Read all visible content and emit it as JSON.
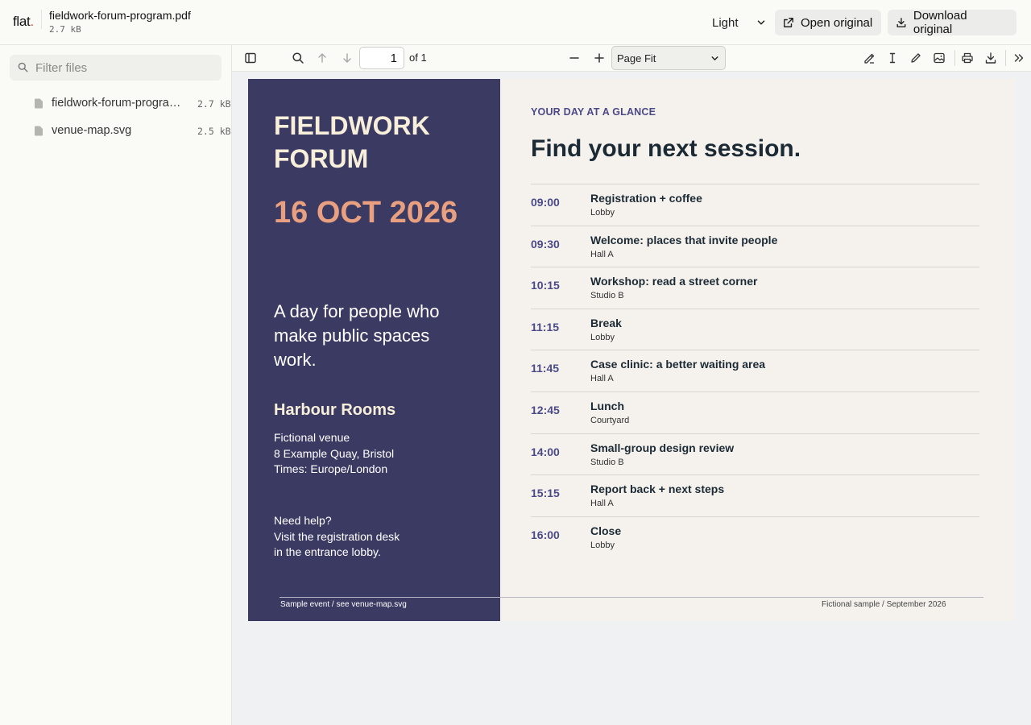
{
  "header": {
    "logo_text": "flat",
    "logo_dot": ".",
    "file_title": "fieldwork-forum-program.pdf",
    "file_size": "2.7 kB",
    "theme_value": "Light",
    "open_label": "Open original",
    "download_label": "Download original"
  },
  "sidebar": {
    "filter_placeholder": "Filter files",
    "files": [
      {
        "name": "fieldwork-forum-program.pdf",
        "size": "2.7 kB",
        "icon": "file-icon"
      },
      {
        "name": "venue-map.svg",
        "size": "2.5 kB",
        "icon": "file-icon"
      }
    ]
  },
  "viewer": {
    "page_number": "1",
    "page_count": "of 1",
    "zoom_value": "Page Fit"
  },
  "document": {
    "title": "FIELDWORK FORUM",
    "date": "16 OCT 2026",
    "tagline": "A day for people who make public spaces work.",
    "venue": "Harbour Rooms",
    "address_lines": [
      "Fictional venue",
      "8 Example Quay, Bristol",
      "Times: Europe/London"
    ],
    "help_lines": [
      "Need help?",
      "Visit the registration desk",
      "in the entrance lobby."
    ],
    "kicker": "YOUR DAY AT A GLANCE",
    "heading": "Find your next session.",
    "schedule": [
      {
        "time": "09:00",
        "title": "Registration + coffee",
        "room": "Lobby"
      },
      {
        "time": "09:30",
        "title": "Welcome: places that invite people",
        "room": "Hall A"
      },
      {
        "time": "10:15",
        "title": "Workshop: read a street corner",
        "room": "Studio B"
      },
      {
        "time": "11:15",
        "title": "Break",
        "room": "Lobby"
      },
      {
        "time": "11:45",
        "title": "Case clinic: a better waiting area",
        "room": "Hall A"
      },
      {
        "time": "12:45",
        "title": "Lunch",
        "room": "Courtyard"
      },
      {
        "time": "14:00",
        "title": "Small-group design review",
        "room": "Studio B"
      },
      {
        "time": "15:15",
        "title": "Report back + next steps",
        "room": "Hall A"
      },
      {
        "time": "16:00",
        "title": "Close",
        "room": "Lobby"
      }
    ],
    "footer_left": "Sample event / see venue-map.svg",
    "footer_right": "Fictional sample / September 2026"
  },
  "colors": {
    "panel": "#3b3a63",
    "accent_time": "#4b4a86",
    "date": "#e8a080",
    "cream": "#f7efd9",
    "page_bg": "#f5f2ee",
    "logo_dot": "#e0533a"
  }
}
